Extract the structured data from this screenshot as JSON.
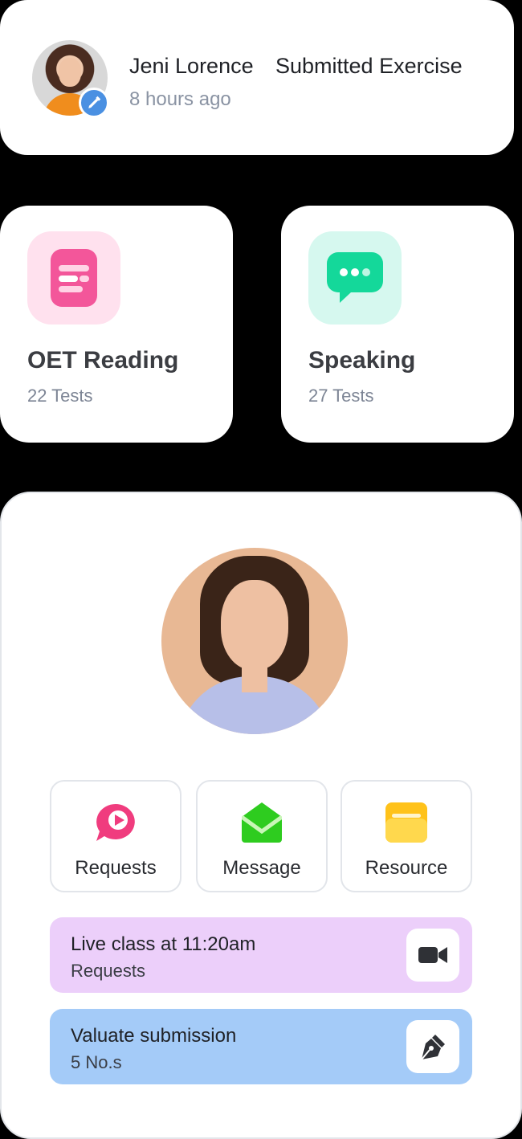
{
  "activity": {
    "user_name": "Jeni Lorence",
    "action": "Submitted Exercise",
    "time": "8 hours ago",
    "badge_icon": "pencil-icon",
    "badge_color": "#4a90e2"
  },
  "categories": [
    {
      "title": "OET Reading",
      "subtitle": "22 Tests",
      "icon": "reading-list-icon",
      "icon_bg": "#ffe1ee",
      "icon_color": "#f3569a"
    },
    {
      "title": "Speaking",
      "subtitle": "27 Tests",
      "icon": "chat-bubble-icon",
      "icon_bg": "#d6f8ef",
      "icon_color": "#14d89a"
    }
  ],
  "profile": {
    "actions": [
      {
        "label": "Requests",
        "icon": "play-bubble-icon",
        "color": "#f03c7e"
      },
      {
        "label": "Message",
        "icon": "envelope-icon",
        "color": "#2ecc1f"
      },
      {
        "label": "Resource",
        "icon": "folder-icon",
        "color": "#ffc21a"
      }
    ],
    "tasks": [
      {
        "title": "Live class at 11:20am",
        "subtitle": "Requests",
        "icon": "video-camera-icon",
        "bg": "#eccffa"
      },
      {
        "title": "Valuate submission",
        "subtitle": "5 No.s",
        "icon": "pen-nib-icon",
        "bg": "#a4cbf8"
      }
    ]
  }
}
